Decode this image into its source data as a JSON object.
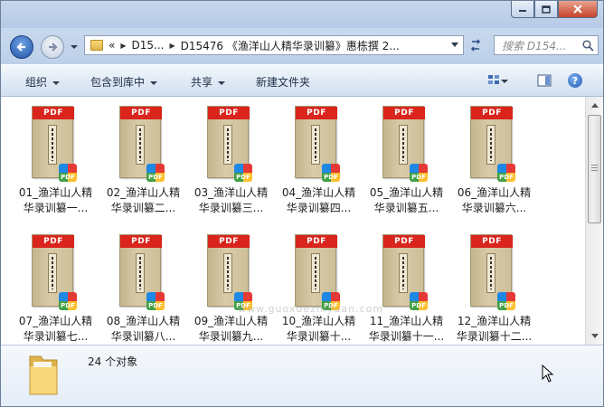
{
  "address": {
    "overflow_chevron": "«",
    "crumbs": [
      "D15...",
      "D15476 《渔洋山人精华录训纂》惠栋撰 2..."
    ]
  },
  "search": {
    "placeholder": "搜索 D154..."
  },
  "toolbar": {
    "organize": "组织",
    "include_in_library": "包含到库中",
    "share": "共享",
    "new_folder": "新建文件夹"
  },
  "files": [
    {
      "line1": "01_渔洋山人精",
      "line2": "华录训纂一..."
    },
    {
      "line1": "02_渔洋山人精",
      "line2": "华录训纂二..."
    },
    {
      "line1": "03_渔洋山人精",
      "line2": "华录训纂三..."
    },
    {
      "line1": "04_渔洋山人精",
      "line2": "华录训纂四..."
    },
    {
      "line1": "05_渔洋山人精",
      "line2": "华录训纂五..."
    },
    {
      "line1": "06_渔洋山人精",
      "line2": "华录训纂六..."
    },
    {
      "line1": "07_渔洋山人精",
      "line2": "华录训纂七..."
    },
    {
      "line1": "08_渔洋山人精",
      "line2": "华录训纂八..."
    },
    {
      "line1": "09_渔洋山人精",
      "line2": "华录训纂九..."
    },
    {
      "line1": "10_渔洋山人精",
      "line2": "华录训纂十..."
    },
    {
      "line1": "11_渔洋山人精",
      "line2": "华录训纂十一..."
    },
    {
      "line1": "12_渔洋山人精",
      "line2": "华录训纂十二..."
    }
  ],
  "thumbnail_banner": "PDF",
  "badge_text": "PDF",
  "details": {
    "item_count": "24 个对象"
  },
  "watermark": "www.guoxuezhiyuan.com",
  "icons": {
    "back": "back-arrow-icon",
    "forward": "forward-arrow-icon",
    "refresh": "refresh-icon",
    "search": "search-icon",
    "view": "change-view-icon",
    "preview": "preview-pane-icon",
    "help": "help-icon"
  },
  "colors": {
    "pdf_red": "#d9251c",
    "chrome_blue": "#dfe9f5"
  }
}
